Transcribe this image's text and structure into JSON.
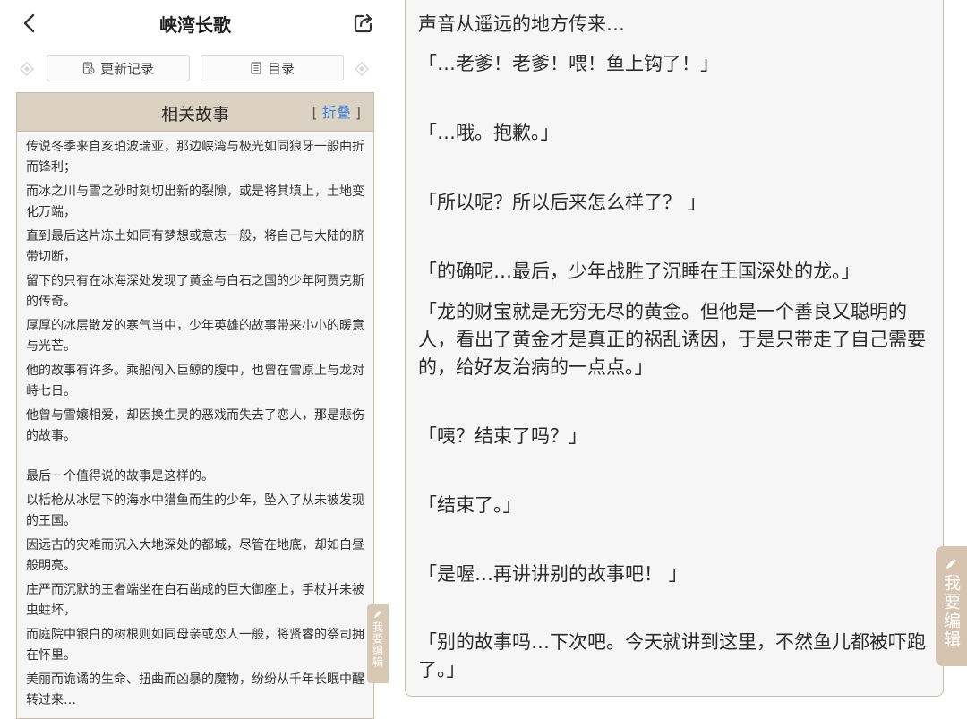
{
  "header": {
    "title": "峡湾长歌"
  },
  "buttons": {
    "update_log": "更新记录",
    "catalog": "目录"
  },
  "panel": {
    "title": "相关故事",
    "fold_open": "[",
    "fold_label": "折叠",
    "fold_close": "]"
  },
  "story": [
    "传说冬季来自亥珀波瑞亚，那边峡湾与极光如同狼牙一般曲折而锋利；",
    "而冰之川与雪之砂时刻切出新的裂隙，或是将其填上，土地变化万端，",
    "直到最后这片冻土如同有梦想或意志一般，将自己与大陆的脐带切断，",
    "留下的只有在冰海深处发现了黄金与白石之国的少年阿贾克斯的传奇。",
    "厚厚的冰层散发的寒气当中，少年英雄的故事带来小小的暖意与光芒。",
    "他的故事有许多。乘船闯入巨鲸的腹中，也曾在雪原上与龙对峙七日。",
    "他曾与雪孃相爱，却因换生灵的恶戏而失去了恋人，那是悲伤的故事。",
    "最后一个值得说的故事是这样的。",
    "以栝枪从冰层下的海水中猎鱼而生的少年，坠入了从未被发现的王国。",
    "因远古的灾难而沉入大地深处的都城，尽管在地底，却如白昼般明亮。",
    "庄严而沉默的王者端坐在白石凿成的巨大御座上，手杖并未被虫蛀坏，",
    "而庭院中银白的树根则如同母亲或恋人一般，将贤睿的祭司拥在怀里。",
    "美丽而诡谲的生命、扭曲而凶暴的魔物，纷纷从千年长眠中醒转过来…"
  ],
  "edit_tab": {
    "label": "我要编辑"
  },
  "dialogue": [
    "声音从遥远的地方传来…",
    "「…老爹！老爹！喂！鱼上钩了！」",
    "「…哦。抱歉。」",
    "「所以呢？所以后来怎么样了？ 」",
    "「的确呢…最后，少年战胜了沉睡在王国深处的龙。」",
    "「龙的财宝就是无穷无尽的黄金。但他是一个善良又聪明的人，看出了黄金才是真正的祸乱诱因，于是只带走了自己需要的，给好友治病的一点点。」",
    "「咦？结束了吗？」",
    "「结束了。」",
    "「是喔…再讲讲别的故事吧！ 」",
    "「别的故事吗…下次吧。今天就讲到这里，不然鱼儿都被吓跑了。」"
  ]
}
